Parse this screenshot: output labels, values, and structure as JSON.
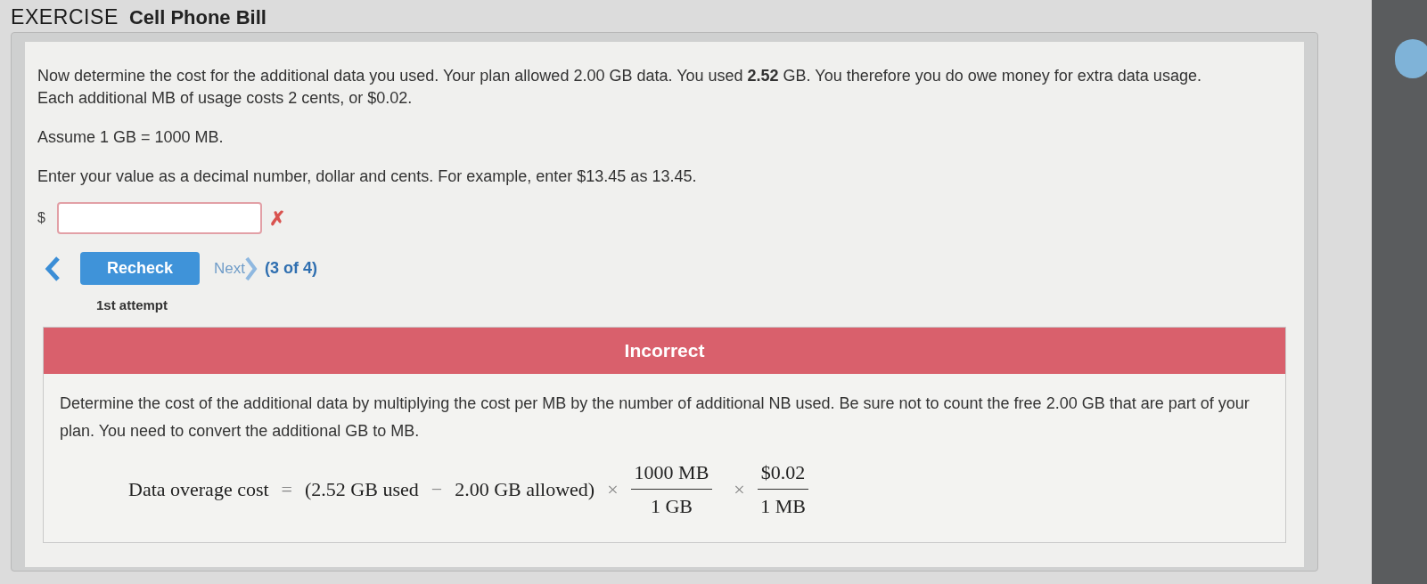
{
  "header": {
    "label": "EXERCISE",
    "title": "Cell Phone Bill"
  },
  "problem": {
    "paragraphs": [
      "Now determine the cost for the additional data you used. Your plan allowed 2.00 GB data. You used **2.52** GB. You therefore you do owe money for extra data usage. Each additional MB of usage costs 2 cents, or $0.02.",
      "Assume 1 GB = 1000 MB.",
      "Enter your value as a decimal number, dollar and cents. For example, enter $13.45 as 13.45."
    ]
  },
  "answer": {
    "prefix": "$",
    "correct": false,
    "mark": "✗"
  },
  "navigation": {
    "recheck": "Recheck",
    "next": {
      "label": "Next",
      "disabled": true
    },
    "progress": "(3 of 4)",
    "attempt": "1st attempt"
  },
  "feedback": {
    "correct": false,
    "banner": "Incorrect",
    "text": "Determine the cost of the additional data by multiplying the cost per MB by the number of additional NB used. Be sure not to count the free 2.00 GB that are part of your plan. You need to convert the additional GB to MB.",
    "formula": {
      "lhs": "Data overage cost",
      "equals": "=",
      "term1": "(2.52 GB used",
      "minus": "−",
      "term2": "2.00 GB allowed)",
      "times1": "×",
      "fraction1": {
        "numerator": "1000 MB",
        "denominator": "1 GB"
      },
      "times2": "×",
      "fraction2": {
        "numerator": "$0.02",
        "denominator": "1 MB"
      }
    }
  }
}
